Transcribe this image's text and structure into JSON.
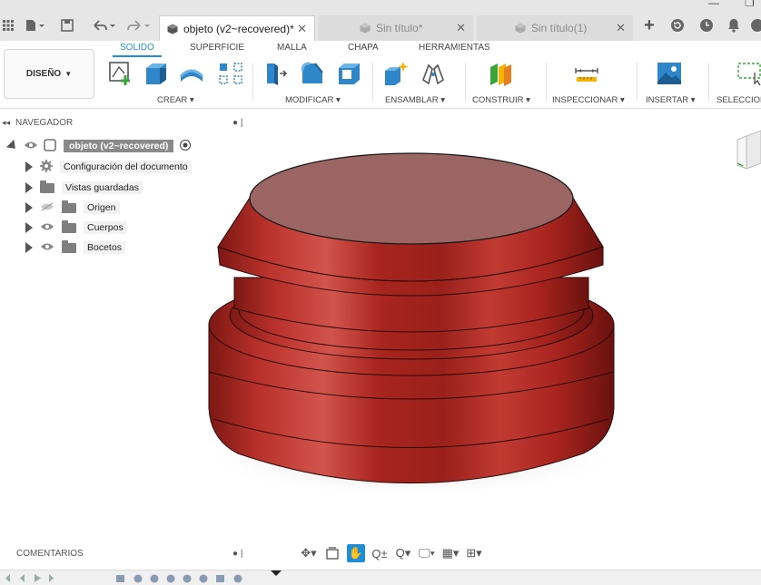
{
  "tabs": [
    {
      "label": "objeto (v2~recovered)*",
      "active": true
    },
    {
      "label": "Sin título*",
      "active": false
    },
    {
      "label": "Sin título(1)",
      "active": false
    }
  ],
  "ribbon": {
    "design_label": "DISEÑO",
    "tabs": [
      "SOLIDO",
      "SUPERFICIE",
      "MALLA",
      "CHAPA",
      "HERRAMIENTAS"
    ],
    "active_tab": "SOLIDO",
    "groups": [
      "CREAR",
      "MODIFICAR",
      "ENSAMBLAR",
      "CONSTRUIR",
      "INSPECCIONAR",
      "INSERTAR",
      "SELECCION"
    ]
  },
  "browser": {
    "title": "NAVEGADOR",
    "root": "objeto (v2~recovered)",
    "items": [
      {
        "label": "Configuración del documento"
      },
      {
        "label": "Vistas guardadas"
      },
      {
        "label": "Origen"
      },
      {
        "label": "Cuerpos"
      },
      {
        "label": "Bocetos"
      }
    ]
  },
  "comments_label": "COMENTARIOS",
  "colors": {
    "body_red": "#b0241f",
    "accent_blue": "#1e8fd6"
  },
  "icons": [
    "grid-apps-icon",
    "file-icon",
    "save-icon",
    "undo-icon",
    "redo-icon",
    "plus-icon",
    "refresh-icon",
    "clock-icon",
    "bell-icon"
  ]
}
